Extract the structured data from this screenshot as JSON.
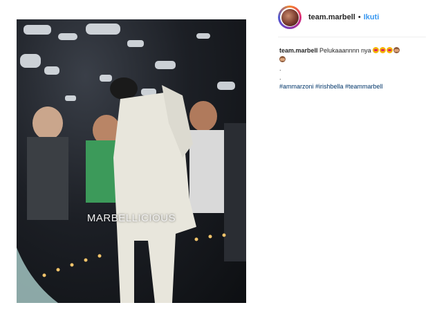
{
  "post": {
    "username": "team.marbell",
    "separator": "•",
    "follow_label": "Ikuti"
  },
  "media": {
    "watermark": "MARBELLICIOUS",
    "colors": {
      "suit": "#e8e6dc",
      "shirt_green": "#3c9a5a",
      "lights": "#f2c46b"
    }
  },
  "caption": {
    "username": "team.marbell",
    "text": "Pelukaaannnn nya",
    "dot1": ".",
    "dot2": ".",
    "hashtags": "#ammarzoni #irishbella #teammarbell",
    "emojis": [
      "heart-eyes-icon",
      "heart-eyes-icon",
      "heart-eyes-icon",
      "see-no-evil-monkey-icon",
      "see-no-evil-monkey-icon"
    ]
  }
}
